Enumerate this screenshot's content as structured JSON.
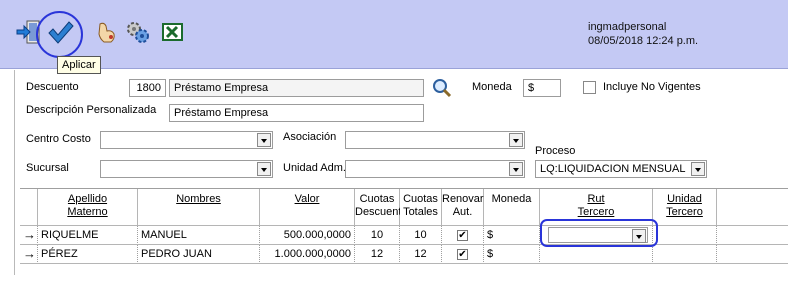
{
  "toolbar": {
    "user_name": "ingmadpersonal",
    "datetime": "08/05/2018 12:24 p.m.",
    "tooltip": "Aplicar",
    "buttons": [
      "exit-icon",
      "checkmark-icon",
      "hand-pointer-icon",
      "gears-icon",
      "excel-icon"
    ]
  },
  "form": {
    "descuento_label": "Descuento",
    "descuento_code": "1800",
    "descuento_name": "Préstamo Empresa",
    "moneda_label": "Moneda",
    "moneda_value": "$",
    "incluye_label": "Incluye No Vigentes",
    "descripcion_label": "Descripción Personalizada",
    "descripcion_value": "Préstamo Empresa",
    "centro_costo_label": "Centro Costo",
    "centro_costo_value": "",
    "asociacion_label": "Asociación",
    "asociacion_value": "",
    "proceso_label": "Proceso",
    "proceso_value": "LQ:LIQUIDACION MENSUAL",
    "sucursal_label": "Sucursal",
    "sucursal_value": "",
    "unidad_adm_label": "Unidad Adm.",
    "unidad_adm_value": ""
  },
  "grid": {
    "headers": {
      "apellido": [
        "Apellido",
        "Materno"
      ],
      "nombres": "Nombres",
      "valor": "Valor",
      "cuotas_desc": [
        "Cuotas",
        "Descuento"
      ],
      "cuotas_tot": [
        "Cuotas",
        "Totales"
      ],
      "renovar": [
        "Renovar",
        "Aut."
      ],
      "moneda": "Moneda",
      "rut": [
        "Rut",
        "Tercero"
      ],
      "unidad": [
        "Unidad",
        "Tercero"
      ]
    },
    "rows": [
      {
        "apellido": "RIQUELME",
        "nombres": "MANUEL",
        "valor": "500.000,0000",
        "cuotas_desc": "10",
        "cuotas_tot": "10",
        "renovar": "✔",
        "moneda": "$"
      },
      {
        "apellido": "PÉREZ",
        "nombres": "PEDRO JUAN",
        "valor": "1.000.000,0000",
        "cuotas_desc": "12",
        "cuotas_tot": "12",
        "renovar": "✔",
        "moneda": "$"
      }
    ]
  }
}
